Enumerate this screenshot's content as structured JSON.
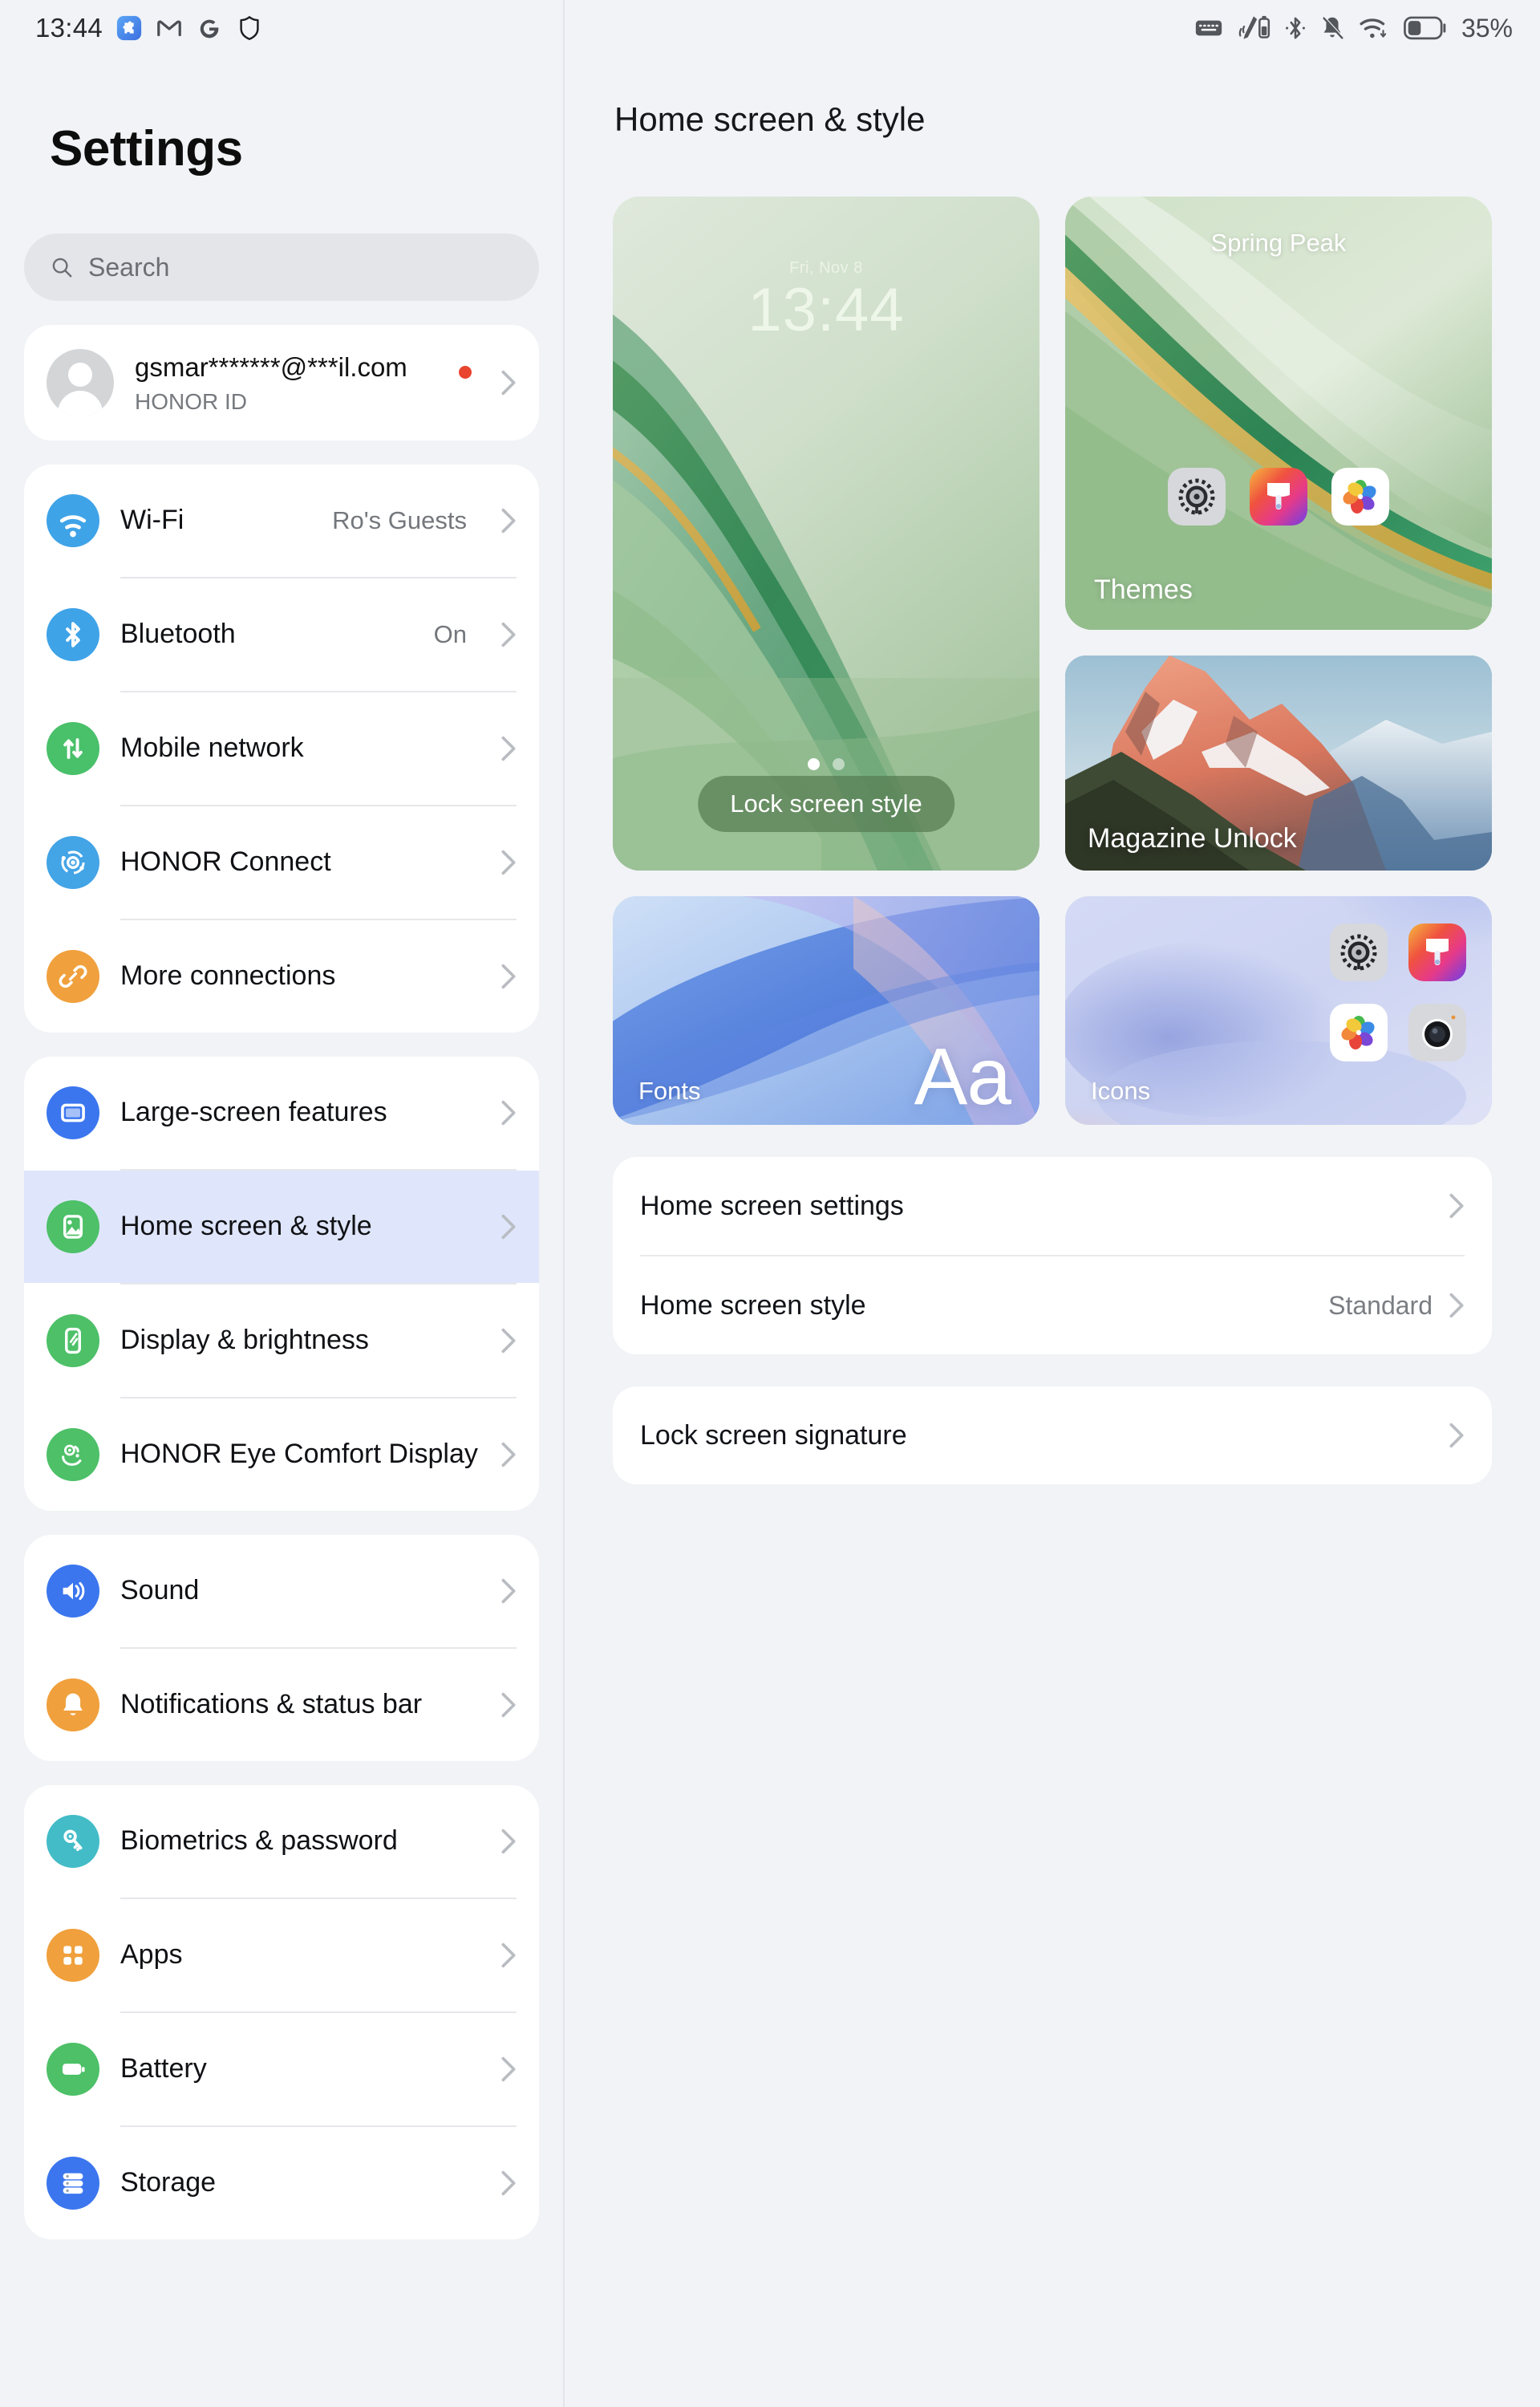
{
  "statusbar": {
    "time": "13:44",
    "battery_percent": "35%",
    "left_icons": [
      "extension-puzzle-icon",
      "gmail-icon",
      "google-icon",
      "shield-icon"
    ],
    "right_icons": [
      "keyboard-icon",
      "stylus-battery-icon",
      "bluetooth-icon",
      "bell-muted-icon",
      "wifi-icon",
      "battery-icon"
    ]
  },
  "sidebar": {
    "title": "Settings",
    "search": {
      "placeholder": "Search"
    },
    "account": {
      "email": "gsmar*******@***il.com",
      "subtitle": "HONOR ID",
      "has_badge": true
    },
    "groups": [
      {
        "items": [
          {
            "label": "Wi-Fi",
            "value": "Ro's Guests",
            "icon": "wifi-icon",
            "color": "#3fa3e8",
            "selected": false
          },
          {
            "label": "Bluetooth",
            "value": "On",
            "icon": "bluetooth-icon",
            "color": "#3fa3e8",
            "selected": false
          },
          {
            "label": "Mobile network",
            "value": "",
            "icon": "mobile-network-icon",
            "color": "#49c06a",
            "selected": false
          },
          {
            "label": "HONOR Connect",
            "value": "",
            "icon": "honor-connect-icon",
            "color": "#43a4e6",
            "selected": false
          },
          {
            "label": "More connections",
            "value": "",
            "icon": "link-icon",
            "color": "#f0a03c",
            "selected": false
          }
        ]
      },
      {
        "items": [
          {
            "label": "Large-screen features",
            "value": "",
            "icon": "tablet-icon",
            "color": "#3b76ef",
            "selected": false
          },
          {
            "label": "Home screen & style",
            "value": "",
            "icon": "image-icon",
            "color": "#4dc068",
            "selected": true
          },
          {
            "label": "Display & brightness",
            "value": "",
            "icon": "display-brightness-icon",
            "color": "#4dc068",
            "selected": false
          },
          {
            "label": "HONOR Eye Comfort Display",
            "value": "",
            "icon": "eye-comfort-icon",
            "color": "#4dc068",
            "selected": false
          }
        ]
      },
      {
        "items": [
          {
            "label": "Sound",
            "value": "",
            "icon": "speaker-icon",
            "color": "#3b76ef",
            "selected": false
          },
          {
            "label": "Notifications & status bar",
            "value": "",
            "icon": "bell-icon",
            "color": "#f0a03c",
            "selected": false
          }
        ]
      },
      {
        "items": [
          {
            "label": "Biometrics & password",
            "value": "",
            "icon": "key-icon",
            "color": "#43bcc7",
            "selected": false
          },
          {
            "label": "Apps",
            "value": "",
            "icon": "apps-grid-icon",
            "color": "#f0a03c",
            "selected": false
          },
          {
            "label": "Battery",
            "value": "",
            "icon": "battery-icon",
            "color": "#4dc068",
            "selected": false
          },
          {
            "label": "Storage",
            "value": "",
            "icon": "storage-icon",
            "color": "#3b76ef",
            "selected": false
          }
        ]
      }
    ]
  },
  "main": {
    "page_title": "Home screen & style",
    "lock_preview": {
      "date": "Fri, Nov 8",
      "time": "13:44",
      "button_label": "Lock screen style",
      "page_dots": 2,
      "active_dot": 0
    },
    "themes_card": {
      "title": "Spring Peak",
      "label": "Themes",
      "app_icons": [
        "settings-gear-icon",
        "theme-brush-icon",
        "gallery-flower-icon"
      ]
    },
    "magazine_card": {
      "label": "Magazine Unlock"
    },
    "fonts_card": {
      "label": "Fonts",
      "sample": "Aa"
    },
    "icons_card": {
      "label": "Icons",
      "app_icons": [
        "settings-gear-icon",
        "theme-brush-icon",
        "gallery-flower-icon",
        "camera-icon"
      ]
    },
    "settings_groups": [
      {
        "rows": [
          {
            "label": "Home screen settings",
            "value": ""
          },
          {
            "label": "Home screen style",
            "value": "Standard"
          }
        ]
      },
      {
        "rows": [
          {
            "label": "Lock screen signature",
            "value": ""
          }
        ]
      }
    ]
  },
  "colors": {
    "page_bg": "#f1f3f6",
    "card_bg": "#ffffff",
    "selected_row": "#dfe6fb",
    "accent_green": "#4dc068",
    "accent_blue": "#3b76ef"
  }
}
